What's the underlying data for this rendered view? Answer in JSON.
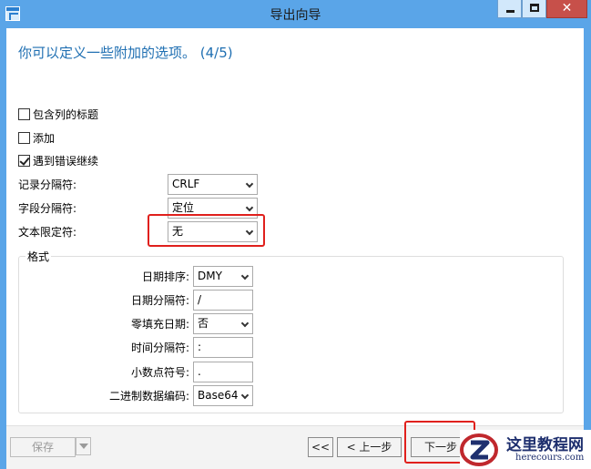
{
  "window": {
    "title": "导出向导"
  },
  "heading": "你可以定义一些附加的选项。 (4/5)",
  "options": {
    "include_column_titles": {
      "label": "包含列的标题",
      "checked": false
    },
    "append": {
      "label": "添加",
      "checked": false
    },
    "continue_on_error": {
      "label": "遇到错误继续",
      "checked": true
    }
  },
  "fields": {
    "record_delimiter": {
      "label": "记录分隔符:",
      "value": "CRLF"
    },
    "field_delimiter": {
      "label": "字段分隔符:",
      "value": "定位"
    },
    "text_qualifier": {
      "label": "文本限定符:",
      "value": "无"
    }
  },
  "format": {
    "title": "格式",
    "date_order": {
      "label": "日期排序:",
      "value": "DMY"
    },
    "date_delimiter": {
      "label": "日期分隔符:",
      "value": "/"
    },
    "zero_padding_date": {
      "label": "零填充日期:",
      "value": "否"
    },
    "time_delimiter": {
      "label": "时间分隔符:",
      "value": ":"
    },
    "decimal_symbol": {
      "label": "小数点符号:",
      "value": "."
    },
    "binary_encoding": {
      "label": "二进制数据编码:",
      "value": "Base64"
    }
  },
  "footer": {
    "save": "保存",
    "first": "<<",
    "previous": "< 上一步",
    "next": "下一步"
  },
  "watermark": {
    "cn": "这里教程网",
    "en": "herecours.com"
  },
  "colors": {
    "titlebar": "#5aa5e8",
    "heading": "#1f6fb2",
    "highlight": "#e0201c",
    "close": "#c7504a"
  }
}
